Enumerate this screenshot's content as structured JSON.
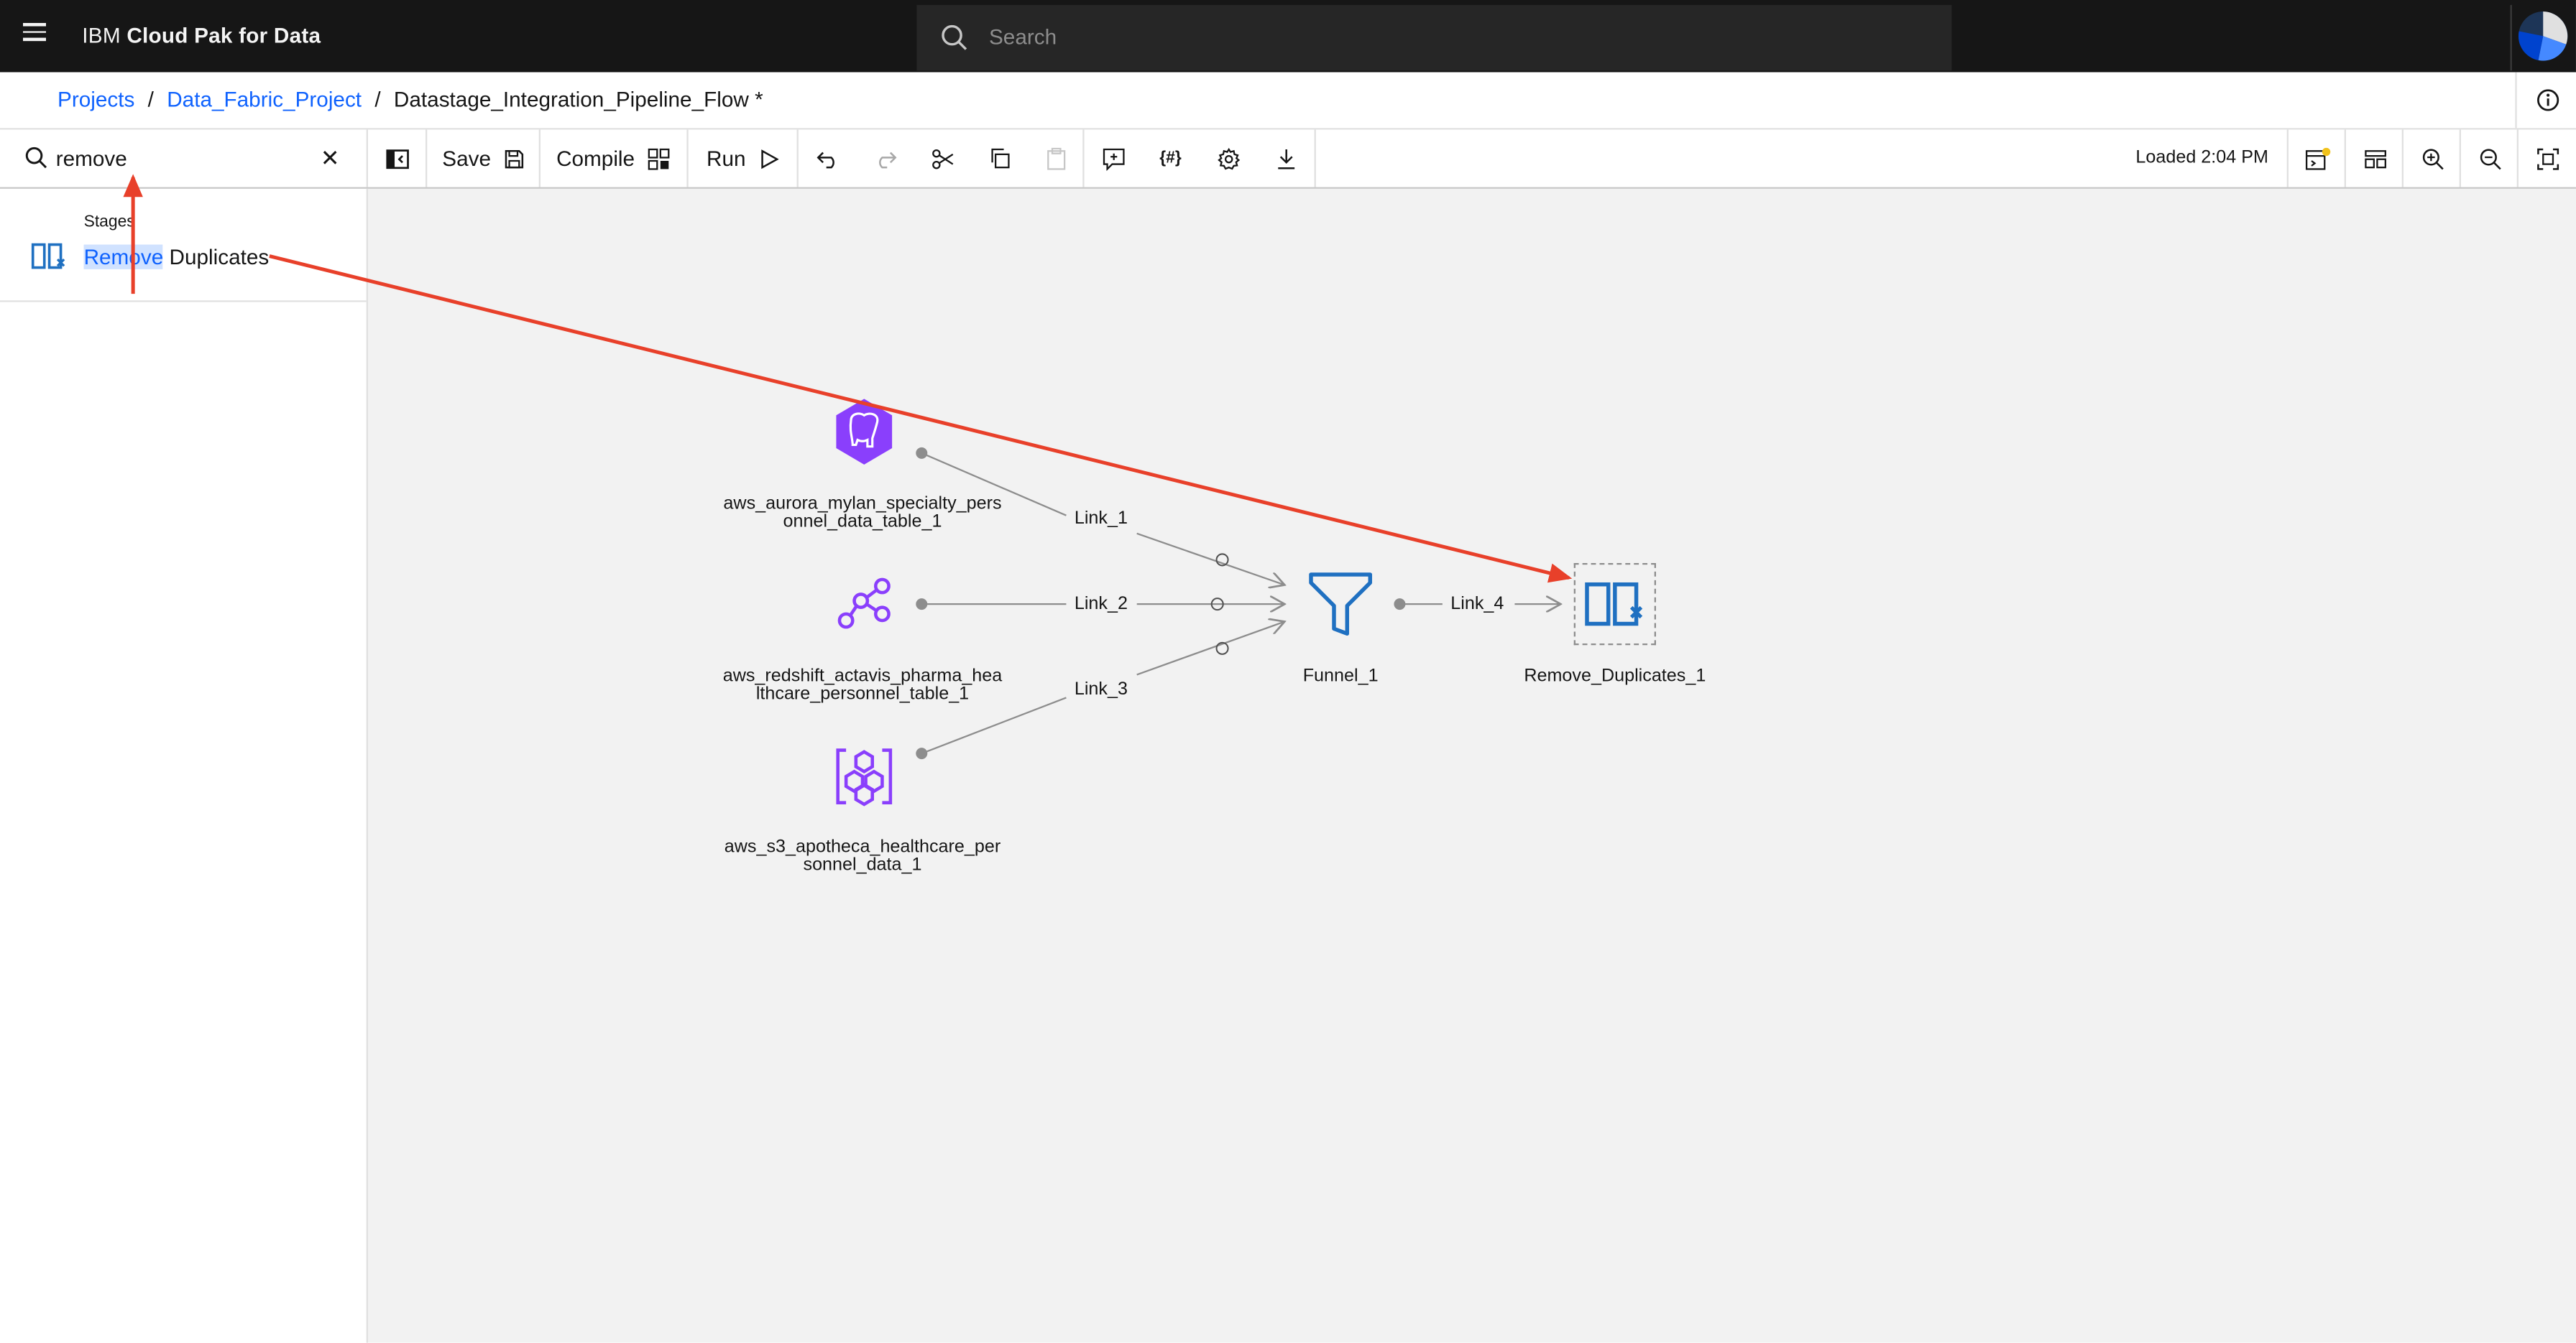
{
  "header": {
    "brand_prefix": "IBM",
    "brand_name": "Cloud Pak for Data",
    "search_placeholder": "Search"
  },
  "breadcrumb": {
    "items": [
      "Projects",
      "Data_Fabric_Project"
    ],
    "current": "Datastage_Integration_Pipeline_Flow *"
  },
  "toolbar": {
    "search_value": "remove",
    "save_label": "Save",
    "compile_label": "Compile",
    "run_label": "Run",
    "status": "Loaded 2:04 PM"
  },
  "palette": {
    "category": "Stages",
    "result_match": "Remove",
    "result_rest": " Duplicates"
  },
  "canvas": {
    "nodes": [
      {
        "label": "aws_aurora_mylan_specialty_personnel_data_table_1",
        "line1": "aws_aurora_mylan_specialty_pers",
        "line2": "onnel_data_table_1",
        "icon": "postgres-elephant-icon"
      },
      {
        "label": "aws_redshift_actavis_pharma_healthcare_personnel_table_1",
        "line1": "aws_redshift_actavis_pharma_hea",
        "line2": "lthcare_personnel_table_1",
        "icon": "redshift-icon"
      },
      {
        "label": "aws_s3_apotheca_healthcare_personnel_data_1",
        "line1": "aws_s3_apotheca_healthcare_per",
        "line2": "sonnel_data_1",
        "icon": "s3-bucket-icon"
      },
      {
        "label": "Funnel_1",
        "icon": "funnel-icon"
      },
      {
        "label": "Remove_Duplicates_1",
        "icon": "remove-duplicates-icon"
      }
    ],
    "links": [
      "Link_1",
      "Link_2",
      "Link_3",
      "Link_4"
    ]
  },
  "colors": {
    "accent": "#0f62fe",
    "stage_blue": "#1f70c1",
    "connector_purple": "#8a3ffc",
    "annotation_red": "#e8402a"
  }
}
